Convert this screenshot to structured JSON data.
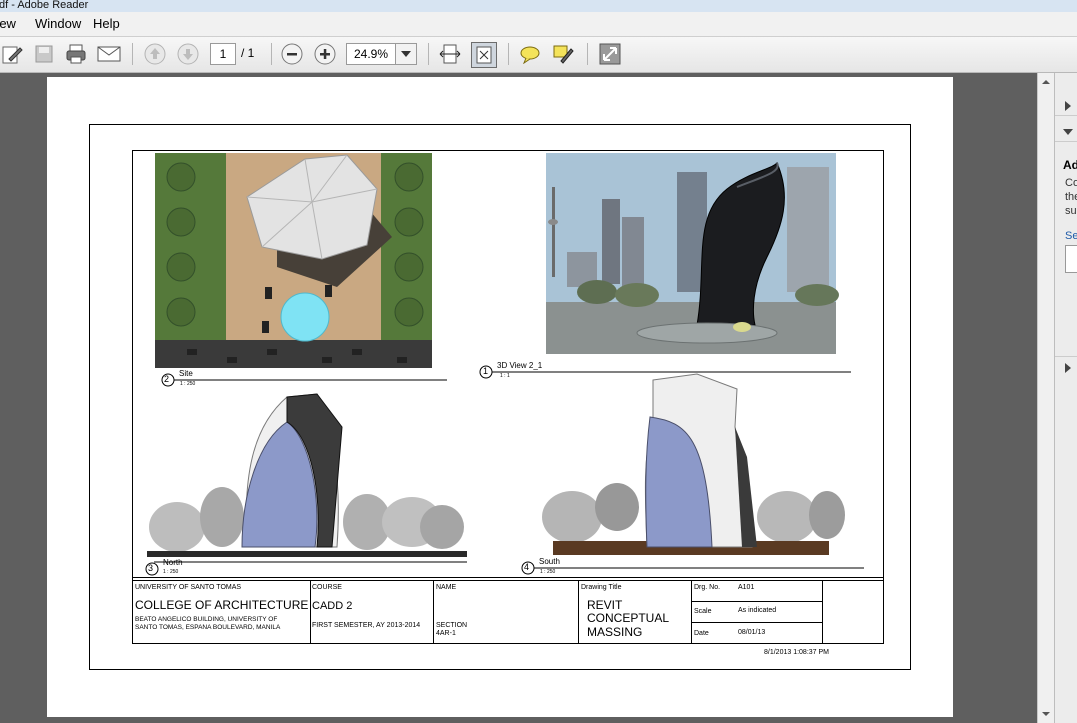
{
  "window": {
    "title": "df - Adobe Reader"
  },
  "menu": {
    "view": "View",
    "window": "Window",
    "help": "Help"
  },
  "toolbar": {
    "page_current": "1",
    "page_total": "/ 1",
    "zoom": "24.9%"
  },
  "sheet": {
    "views": {
      "site": {
        "number": "2",
        "name": "Site",
        "scale": "1 : 250"
      },
      "view3d": {
        "number": "1",
        "name": "3D View 2_1",
        "scale": "1 : 1"
      },
      "north": {
        "number": "3",
        "name": "North",
        "scale": "1 : 250"
      },
      "south": {
        "number": "4",
        "name": "South",
        "scale": "1 : 250"
      }
    },
    "titleblock": {
      "university": "UNIVERSITY OF SANTO TOMAS",
      "college": "COLLEGE OF ARCHITECTURE",
      "address_line1": "BEATO ANGELICO BUILDING, UNIVERSITY OF",
      "address_line2": "SANTO TOMAS, ESPANA BOULEVARD, MANILA",
      "course_label": "COURSE",
      "course": "CADD 2",
      "semester": "FIRST SEMESTER, AY 2013-2014",
      "name_label": "NAME",
      "section_label": "SECTION",
      "section": "4AR-1",
      "drawing_title_label": "Drawing Title",
      "drawing_title_1": "REVIT",
      "drawing_title_2": "CONCEPTUAL",
      "drawing_title_3": "MASSING",
      "drg_no_label": "Drg. No.",
      "drg_no": "A101",
      "scale_label": "Scale",
      "scale": "As indicated",
      "date_label": "Date",
      "date": "08/01/13",
      "timestamp": "8/1/2013 1:08:37 PM"
    }
  },
  "right_panel": {
    "heading": "Ad",
    "line1": "Co",
    "line2": "the",
    "line3": "su",
    "link": "Se"
  },
  "colors": {
    "accent": "#1e5aa8",
    "titlebar": "#d7e4f2",
    "grass": "#55793a",
    "pool": "#7fe3f4",
    "ground": "#5a3a22"
  }
}
